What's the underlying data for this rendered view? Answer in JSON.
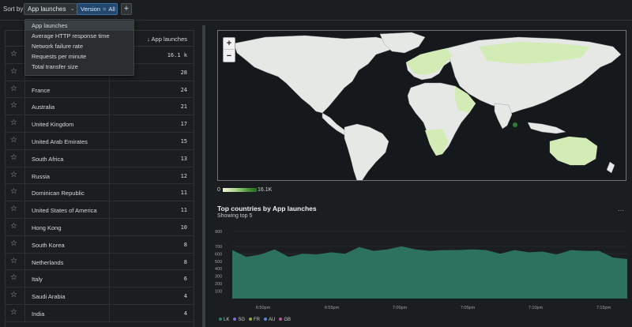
{
  "toolbar": {
    "sort_by_label": "Sort by",
    "sort_selected": "App launches",
    "filter": {
      "key": "Version",
      "operator": "=",
      "value": "All"
    },
    "add_filter_symbol": "+"
  },
  "sort_menu": {
    "options": [
      {
        "label": "App launches",
        "selected": true
      },
      {
        "label": "Average HTTP response time",
        "selected": false
      },
      {
        "label": "Network failure rate",
        "selected": false
      },
      {
        "label": "Requests per minute",
        "selected": false
      },
      {
        "label": "Total transfer size",
        "selected": false
      }
    ]
  },
  "table": {
    "value_header": "↓ App launches",
    "rows": [
      {
        "country": "",
        "value": "16.1 k"
      },
      {
        "country": "",
        "value": "28"
      },
      {
        "country": "France",
        "value": "24"
      },
      {
        "country": "Australia",
        "value": "21"
      },
      {
        "country": "United Kingdom",
        "value": "17"
      },
      {
        "country": "United Arab Emirates",
        "value": "15"
      },
      {
        "country": "South Africa",
        "value": "13"
      },
      {
        "country": "Russia",
        "value": "12"
      },
      {
        "country": "Dominican Republic",
        "value": "11"
      },
      {
        "country": "United States of America",
        "value": "11"
      },
      {
        "country": "Hong Kong",
        "value": "10"
      },
      {
        "country": "South Korea",
        "value": "8"
      },
      {
        "country": "Netherlands",
        "value": "8"
      },
      {
        "country": "Italy",
        "value": "6"
      },
      {
        "country": "Saudi Arabia",
        "value": "4"
      },
      {
        "country": "India",
        "value": "4"
      }
    ]
  },
  "map": {
    "zoom_in": "+",
    "zoom_out": "−",
    "scale_min": "0",
    "scale_max": "16.1K"
  },
  "chart_panel": {
    "title": "Top countries by App launches",
    "subtitle": "Showing top 5",
    "more_symbol": "···"
  },
  "chart_data": {
    "type": "area",
    "title": "Top countries by App launches",
    "y_ticks": [
      "900",
      "700",
      "600",
      "500",
      "400",
      "300",
      "200",
      "100"
    ],
    "ylim": [
      0,
      900
    ],
    "x_ticks": [
      "6:50pm",
      "6:55pm",
      "7:00pm",
      "7:05pm",
      "7:10pm",
      "7:15pm"
    ],
    "series": [
      {
        "name": "LK",
        "color": "#2f7a62",
        "values": [
          650,
          560,
          590,
          660,
          560,
          600,
          590,
          620,
          600,
          690,
          640,
          660,
          700,
          660,
          640,
          650,
          650,
          660,
          650,
          600,
          650,
          620,
          630,
          590,
          650,
          640,
          640,
          550,
          530
        ]
      },
      {
        "name": "SG",
        "color": "#7b6fcf",
        "values": []
      },
      {
        "name": "FR",
        "color": "#9aa43a",
        "values": []
      },
      {
        "name": "AU",
        "color": "#5a86c9",
        "values": []
      },
      {
        "name": "GB",
        "color": "#c0529a",
        "values": []
      }
    ],
    "grid": true
  }
}
